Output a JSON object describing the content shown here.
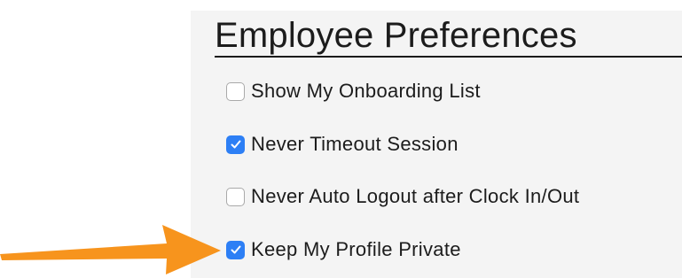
{
  "panel": {
    "title": "Employee Preferences"
  },
  "preferences": [
    {
      "label": "Show My Onboarding List",
      "checked": false
    },
    {
      "label": "Never Timeout Session",
      "checked": true
    },
    {
      "label": "Never Auto Logout after Clock In/Out",
      "checked": false
    },
    {
      "label": "Keep My Profile Private",
      "checked": true
    }
  ],
  "icons": {
    "checked": "checkmark-icon",
    "pointer": "arrow-right-icon"
  },
  "colors": {
    "checkbox_checked": "#2d7ff5",
    "arrow": "#f7941d",
    "panel_background": "#f4f4f4"
  }
}
